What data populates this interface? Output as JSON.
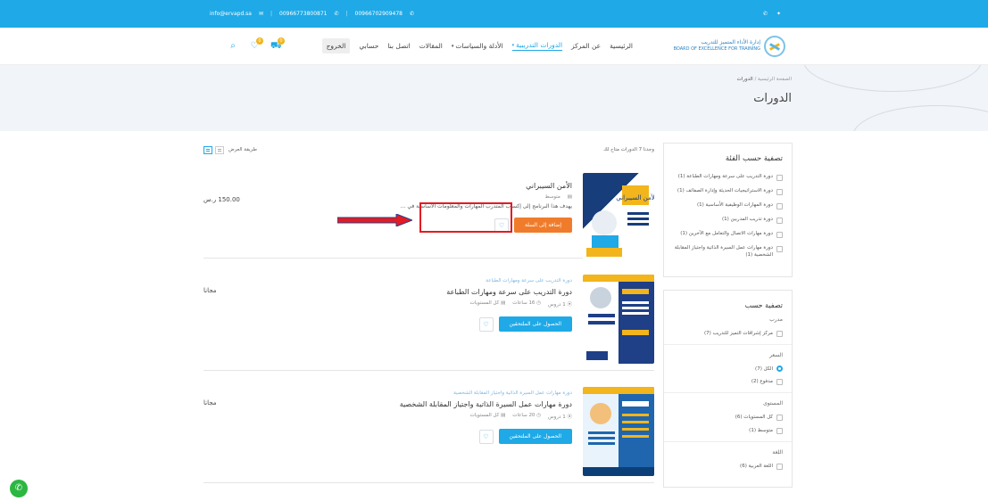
{
  "topbar": {
    "email": "info@ervapd.sa",
    "phone1": "00966773800871",
    "phone2": "00966702909478",
    "social": [
      "whatsapp-icon",
      "twitter-icon"
    ]
  },
  "header": {
    "logo_ar": "إدارة الأداء المتميز للتدريب",
    "logo_en": "BOARD OF EXCELLENCE FOR TRAINING",
    "nav": [
      {
        "label": "الرئيسية"
      },
      {
        "label": "عن المركز"
      },
      {
        "label": "الدورات التدريبية",
        "active": true
      },
      {
        "label": "الأدلة والسياسات"
      },
      {
        "label": "المقالات"
      },
      {
        "label": "اتصل بنا"
      },
      {
        "label": "حسابي"
      },
      {
        "label": "الخروج"
      }
    ],
    "cart_count": "0",
    "wishlist_count": "0"
  },
  "hero": {
    "breadcrumb_home": "الصفحة الرئيسية",
    "breadcrumb_sep": "/",
    "breadcrumb_current": "الدورات",
    "title": "الدورات"
  },
  "toolbar": {
    "found": "وجدنا 7 الدورات متاح لك",
    "display_label": "طريقة العرض"
  },
  "courses": [
    {
      "kicker": "",
      "title": "الأمن السيبراني",
      "level": "متوسط",
      "desc": "يهدف هذا البرنامج إلى إكساب المتدرب المهارات والمعلومات الأساسية في ...",
      "price": "150.00 ر.س",
      "button": "إضافة إلى السلة",
      "thumb_title": "الأمن السيبراني"
    },
    {
      "kicker": "دورة التدريب على سرعة ومهارات الطباعة",
      "title": "دورة التدريب على سرعة ومهارات الطباعة",
      "lessons": "1 دروس",
      "hours": "16 ساعات",
      "level": "كل المستويات",
      "price": "مجانا",
      "button": "الحصول على الملتحقين"
    },
    {
      "kicker": "دورة مهارات عمل السيرة الذاتية واجتياز المقابلة الشخصية",
      "title": "دورة مهارات عمل السيرة الذاتية واجتياز المقابلة الشخصية",
      "lessons": "1 دروس",
      "hours": "20 ساعات",
      "level": "كل المستويات",
      "price": "مجانا",
      "button": "الحصول على الملتحقين"
    }
  ],
  "filters": {
    "category_title": "تصفية حسب الفئة",
    "categories": [
      "دورة التدريب على سرعة ومهارات الطباعة (1)",
      "دورة الاستراتيجيات الحديثة وإدارة الصفائف (1)",
      "دورة المهارات الوظيفية الأساسية (1)",
      "دورة تدريب المدربين (1)",
      "دورة مهارات الاتصال والتعامل مع الآخرين (1)",
      "دورة مهارات عمل السيرة الذاتية واجتياز المقابلة الشخصية"
    ],
    "last_count": "(1)",
    "by_title": "تصفية حسب",
    "trainer_label": "مدرب",
    "trainer_option": "مركز إشراقات التميز للتدريب (7)",
    "price_label": "السعر",
    "price_all": "الكل (7)",
    "price_paid": "مدفوع (2)",
    "level_label": "المستوى",
    "level_all": "كل المستويات (6)",
    "level_mid": "متوسط (1)",
    "lang_label": "اللغة",
    "lang_ar": "اللغة العربية (6)"
  }
}
